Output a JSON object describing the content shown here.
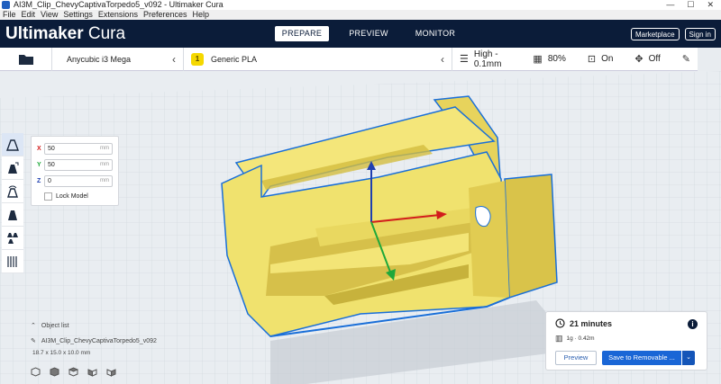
{
  "window": {
    "title": "AI3M_Clip_ChevyCaptivaTorpedo5_v092 - Ultimaker Cura",
    "controls": [
      "—",
      "☐",
      "✕"
    ]
  },
  "menu": [
    "File",
    "Edit",
    "View",
    "Settings",
    "Extensions",
    "Preferences",
    "Help"
  ],
  "header": {
    "brand_bold": "Ultimaker",
    "brand_light": "Cura",
    "tabs": [
      "PREPARE",
      "PREVIEW",
      "MONITOR"
    ],
    "active_tab": "PREPARE",
    "marketplace": "Marketplace",
    "signin": "Sign in"
  },
  "settings_bar": {
    "printer": "Anycubic i3 Mega",
    "material_badge": "1",
    "material": "Generic PLA",
    "profile": "High - 0.1mm",
    "infill": "80%",
    "support": "On",
    "adhesion": "Off"
  },
  "move_panel": {
    "x_label": "X",
    "x_value": "50",
    "y_label": "Y",
    "y_value": "50",
    "z_label": "Z",
    "z_value": "0",
    "unit": "mm",
    "lock_label": "Lock Model"
  },
  "object_list": {
    "header": "Object list",
    "file": "AI3M_Clip_ChevyCaptivaTorpedo5_v092",
    "dimensions": "18.7 x 15.0 x 10.0 mm"
  },
  "print_panel": {
    "time": "21 minutes",
    "material_usage": "1g · 0.42m",
    "preview_label": "Preview",
    "save_label": "Save to Removable ..."
  },
  "colors": {
    "header_bg": "#0b1c39",
    "accent": "#1a66d6",
    "model_fill": "#f2e36c",
    "model_outline": "#1a6fd8",
    "axis_x": "#d21c1c",
    "axis_y": "#1ea83a",
    "axis_z": "#1f3fb0"
  }
}
